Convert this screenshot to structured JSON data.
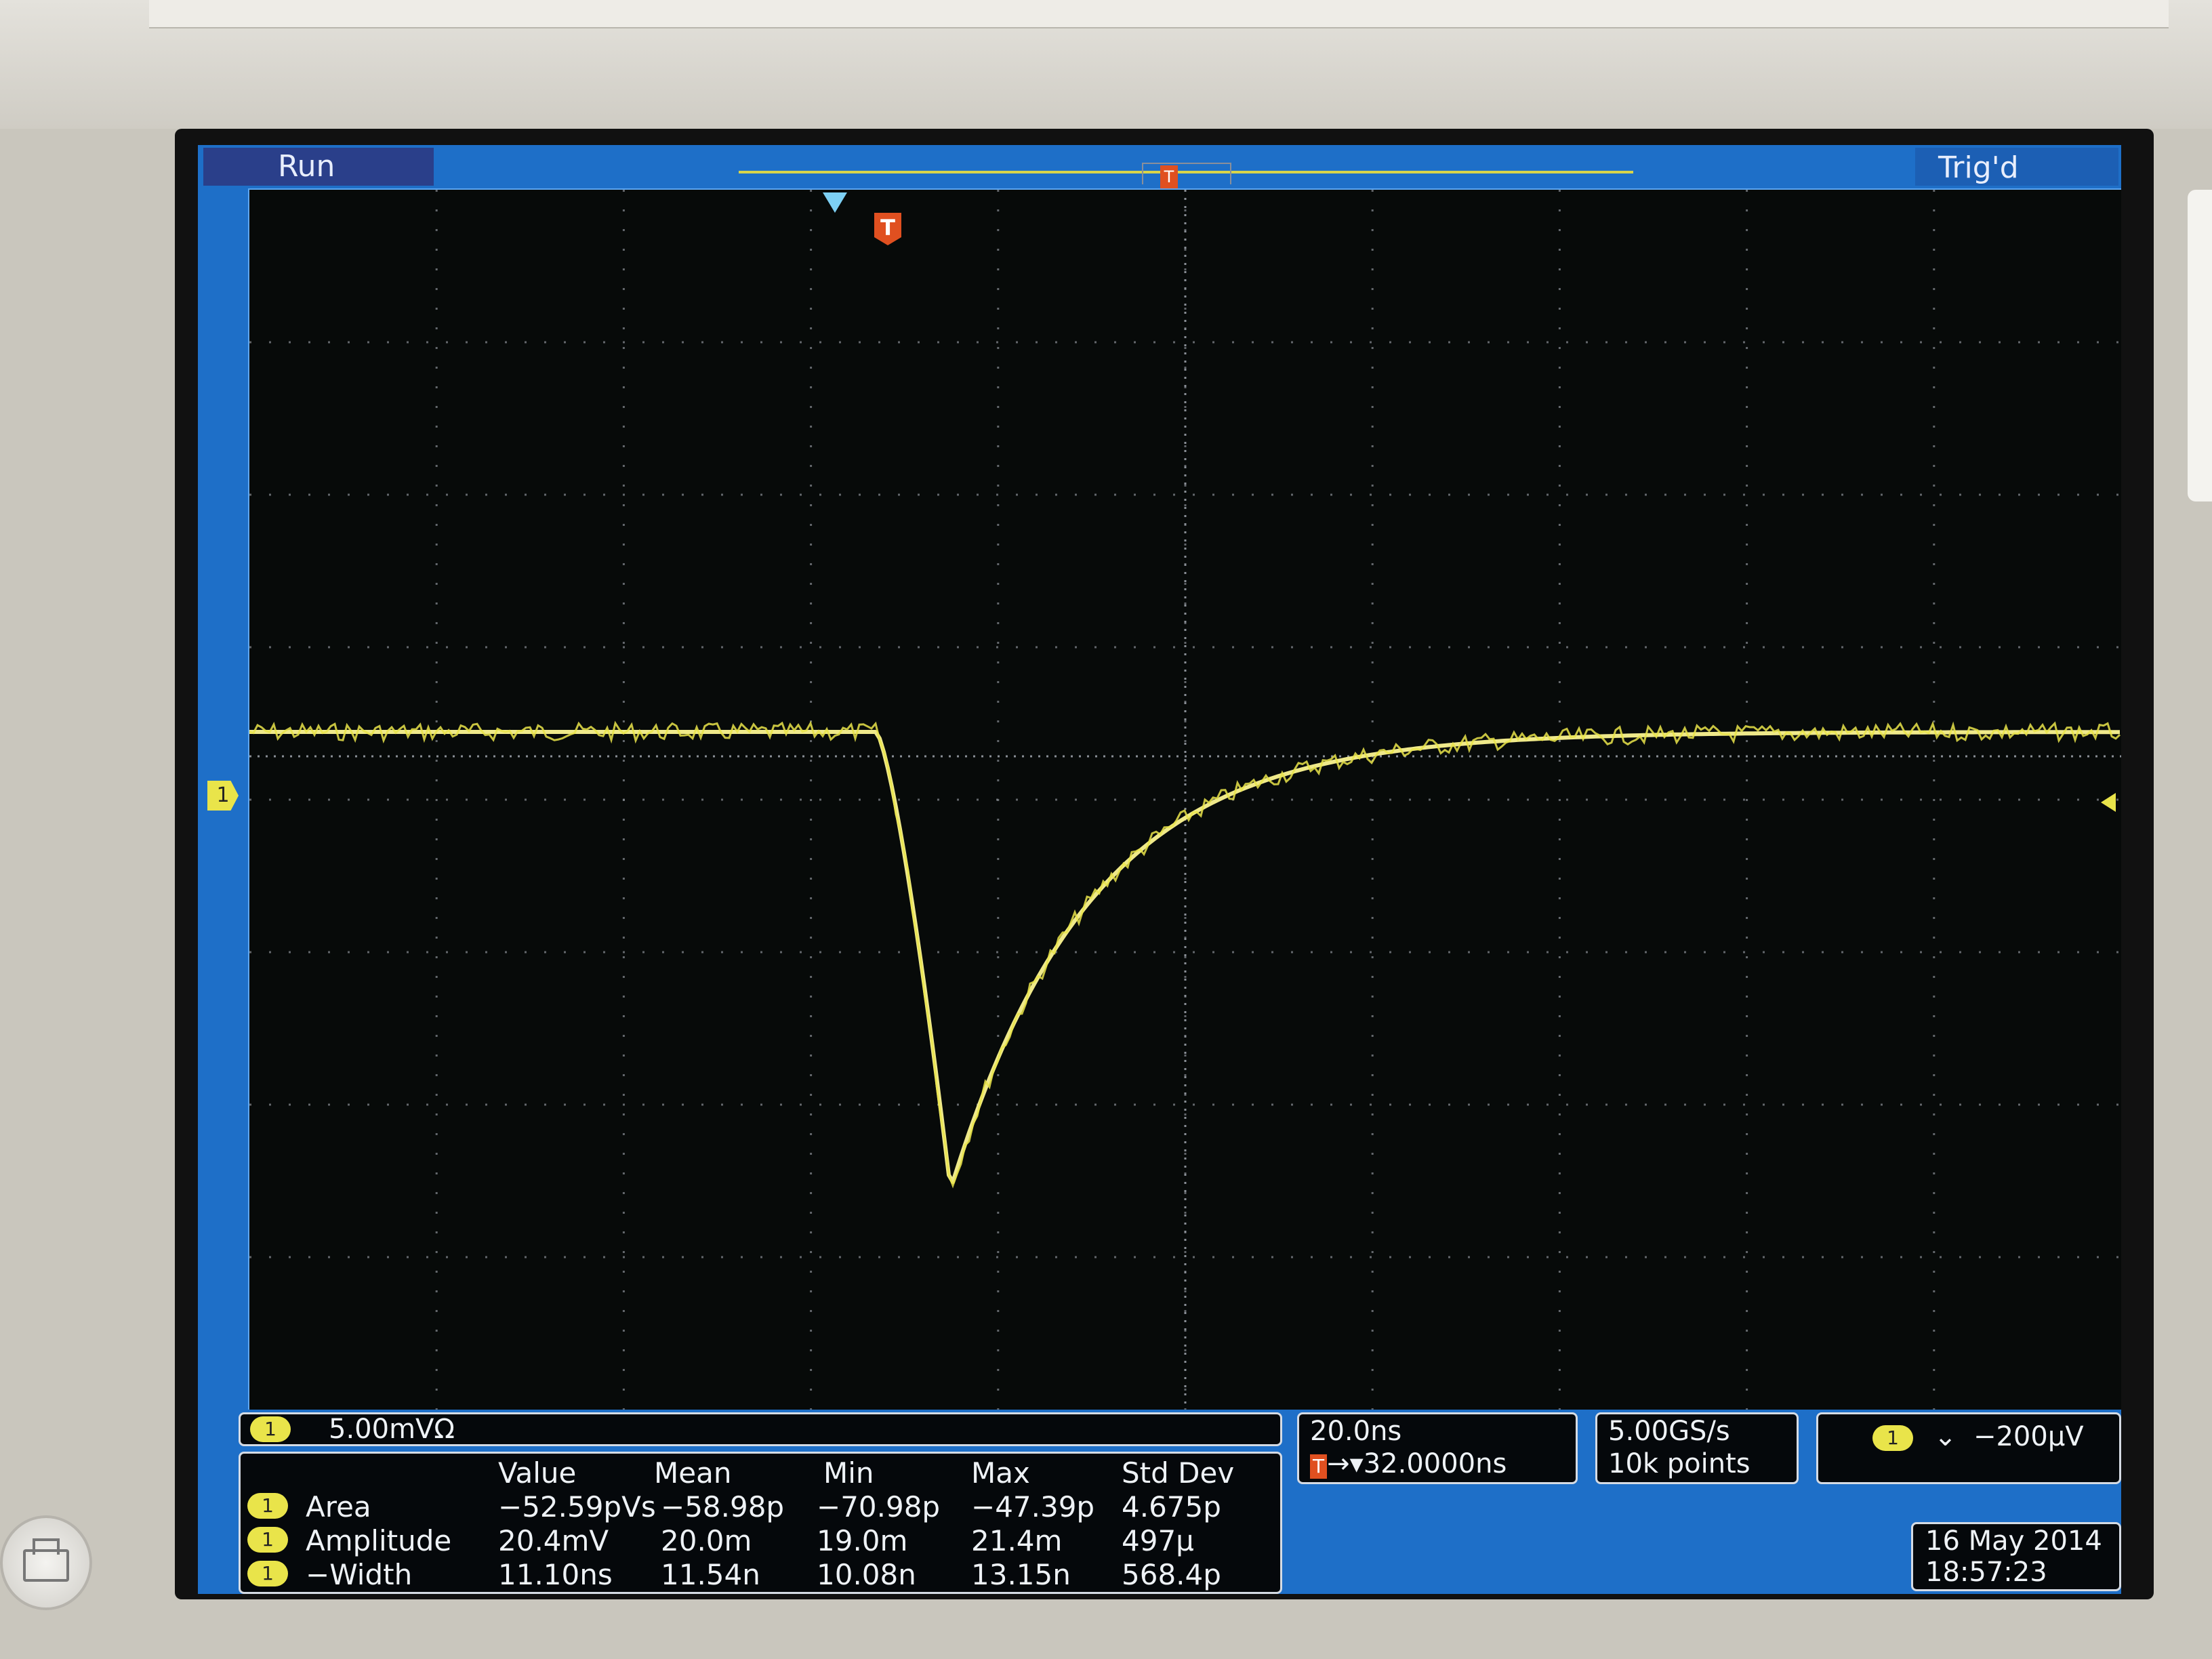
{
  "status": {
    "acquisition": "Run",
    "trigger": "Trig'd"
  },
  "channel": {
    "id": "1",
    "scale": "5.00mVΩ"
  },
  "measurements": {
    "headers": [
      "Value",
      "Mean",
      "Min",
      "Max",
      "Std Dev"
    ],
    "rows": [
      {
        "channel": "1",
        "name": "Area",
        "value": "−52.59pVs",
        "mean": "−58.98p",
        "min": "−70.98p",
        "max": "−47.39p",
        "std": "4.675p"
      },
      {
        "channel": "1",
        "name": "Amplitude",
        "value": "20.4mV",
        "mean": "20.0m",
        "min": "19.0m",
        "max": "21.4m",
        "std": "497μ"
      },
      {
        "channel": "1",
        "name": "−Width",
        "value": "11.10ns",
        "mean": "11.54n",
        "min": "10.08n",
        "max": "13.15n",
        "std": "568.4p"
      }
    ]
  },
  "horizontal": {
    "timebase": "20.0ns",
    "trigger_marker": "T",
    "delay": "→▾32.0000ns"
  },
  "acquisition": {
    "sample_rate": "5.00GS/s",
    "record_length": "10k points"
  },
  "trigger": {
    "channel": "1",
    "slope_symbol": "⌄",
    "level": "−200μV"
  },
  "datetime": {
    "date": "16 May 2014",
    "time": "18:57:23"
  },
  "markers": {
    "trigger_T": "T",
    "ground": "1"
  },
  "colors": {
    "trace": "#efe98a",
    "screen_blue": "#1e6fc8",
    "grid": "#8a8f96"
  },
  "icons": {
    "print": "printer-icon"
  }
}
